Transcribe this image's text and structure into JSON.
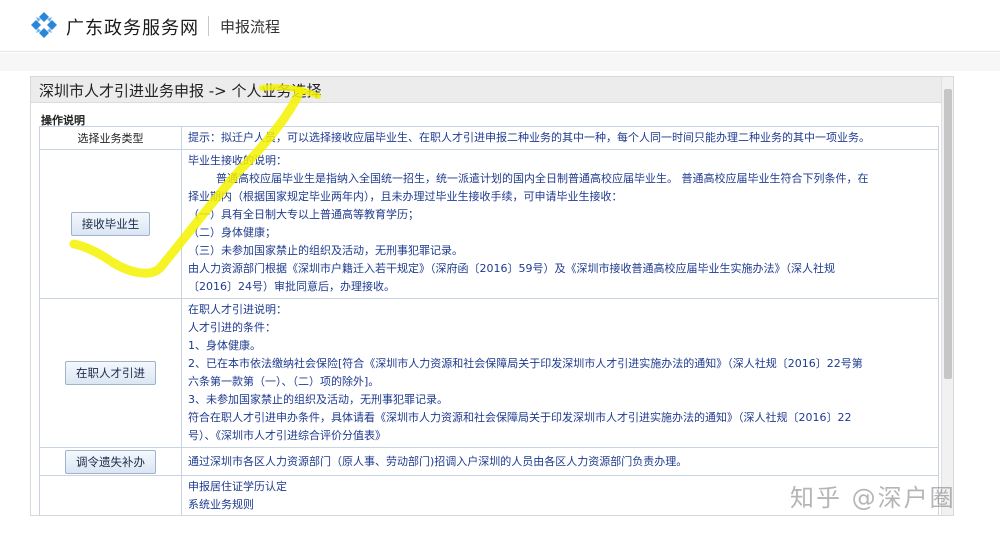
{
  "header": {
    "site_name": "广东政务服务网",
    "subtitle": "申报流程"
  },
  "breadcrumb": "深圳市人才引进业务申报 -> 个人业务选择",
  "section_title": "操作说明",
  "table": {
    "header_left": "选择业务类型",
    "header_right": "提示：拟迁户人员，可以选择接收应届毕业生、在职人才引进申报二种业务的其中一种，每个人同一时间只能办理二种业务的其中一项业务。",
    "rows": [
      {
        "button": "接收毕业生",
        "lines": [
          "毕业生接收的说明：",
          "普通高校应届毕业生是指纳入全国统一招生，统一派遣计划的国内全日制普通高校应届毕业生。  普通高校应届毕业生符合下列条件，在",
          "择业期内（根据国家规定毕业两年内），且未办理过毕业生接收手续，可申请毕业生接收：",
          "（一）具有全日制大专以上普通高等教育学历；",
          "（二）身体健康；",
          "（三）未参加国家禁止的组织及活动，无刑事犯罪记录。",
          "由人力资源部门根据《深圳市户籍迁入若干规定》（深府函〔2016〕59号）及《深圳市接收普通高校应届毕业生实施办法》（深人社规",
          "〔2016〕24号）审批同意后，办理接收。"
        ]
      },
      {
        "button": "在职人才引进",
        "lines": [
          "在职人才引进说明：",
          "人才引进的条件：",
          "1、身体健康。",
          "2、已在本市依法缴纳社会保险[符合《深圳市人力资源和社会保障局关于印发深圳市人才引进实施办法的通知》（深人社规〔2016〕22号第",
          "六条第一款第（一）、（二）项的除外]。",
          "3、未参加国家禁止的组织及活动，无刑事犯罪记录。",
          "符合在职人才引进申办条件，具体请看《深圳市人力资源和社会保障局关于印发深圳市人才引进实施办法的通知》（深人社规〔2016〕22",
          "号）、《深圳市人才引进综合评价分值表》"
        ]
      },
      {
        "button": "调令遗失补办",
        "lines": [
          "通过深圳市各区人力资源部门（原人事、劳动部门)招调入户深圳的人员由各区人力资源部门负责办理。"
        ]
      },
      {
        "button": "",
        "lines": [
          "申报居住证学历认定",
          "系统业务规则"
        ]
      }
    ]
  },
  "watermark": "知乎 @深户圈",
  "colors": {
    "link_blue": "#1f3b8f",
    "logo_blue": "#2a86d6",
    "highlighter": "#f5f200"
  },
  "icons": {
    "logo": "guangdong-gov-logo-icon"
  }
}
